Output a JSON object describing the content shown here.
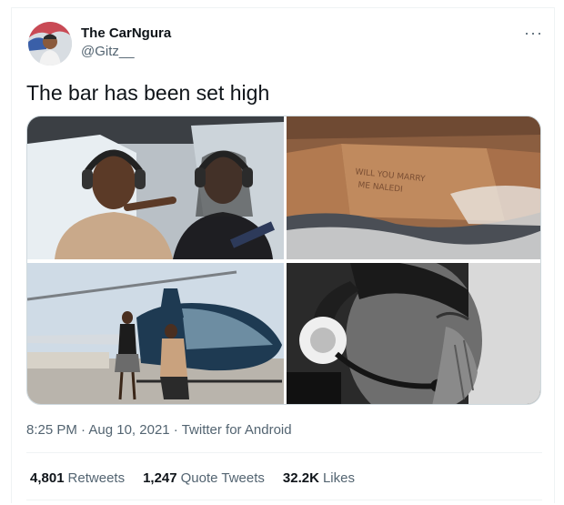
{
  "author": {
    "display_name": "The CarNgura",
    "handle": "@Gitz__"
  },
  "more_icon": "···",
  "tweet": {
    "text": "The bar has been set high"
  },
  "media": {
    "images": [
      {
        "name": "photo-helicopter-interior"
      },
      {
        "name": "photo-sand-message",
        "sign_text_line1": "WILL YOU MARRY",
        "sign_text_line2": "ME NALEDI"
      },
      {
        "name": "photo-helicopter-proposal"
      },
      {
        "name": "photo-woman-crying"
      }
    ]
  },
  "meta": {
    "time": "8:25 PM",
    "sep1": " · ",
    "date": "Aug 10, 2021",
    "sep2": " · ",
    "source": "Twitter for Android"
  },
  "stats": {
    "retweets_count": "4,801",
    "retweets_label": "Retweets",
    "quotes_count": "1,247",
    "quotes_label": "Quote Tweets",
    "likes_count": "32.2K",
    "likes_label": "Likes"
  },
  "colors": {
    "text_primary": "#0f1419",
    "text_secondary": "#536471",
    "divider": "#eff3f4"
  }
}
